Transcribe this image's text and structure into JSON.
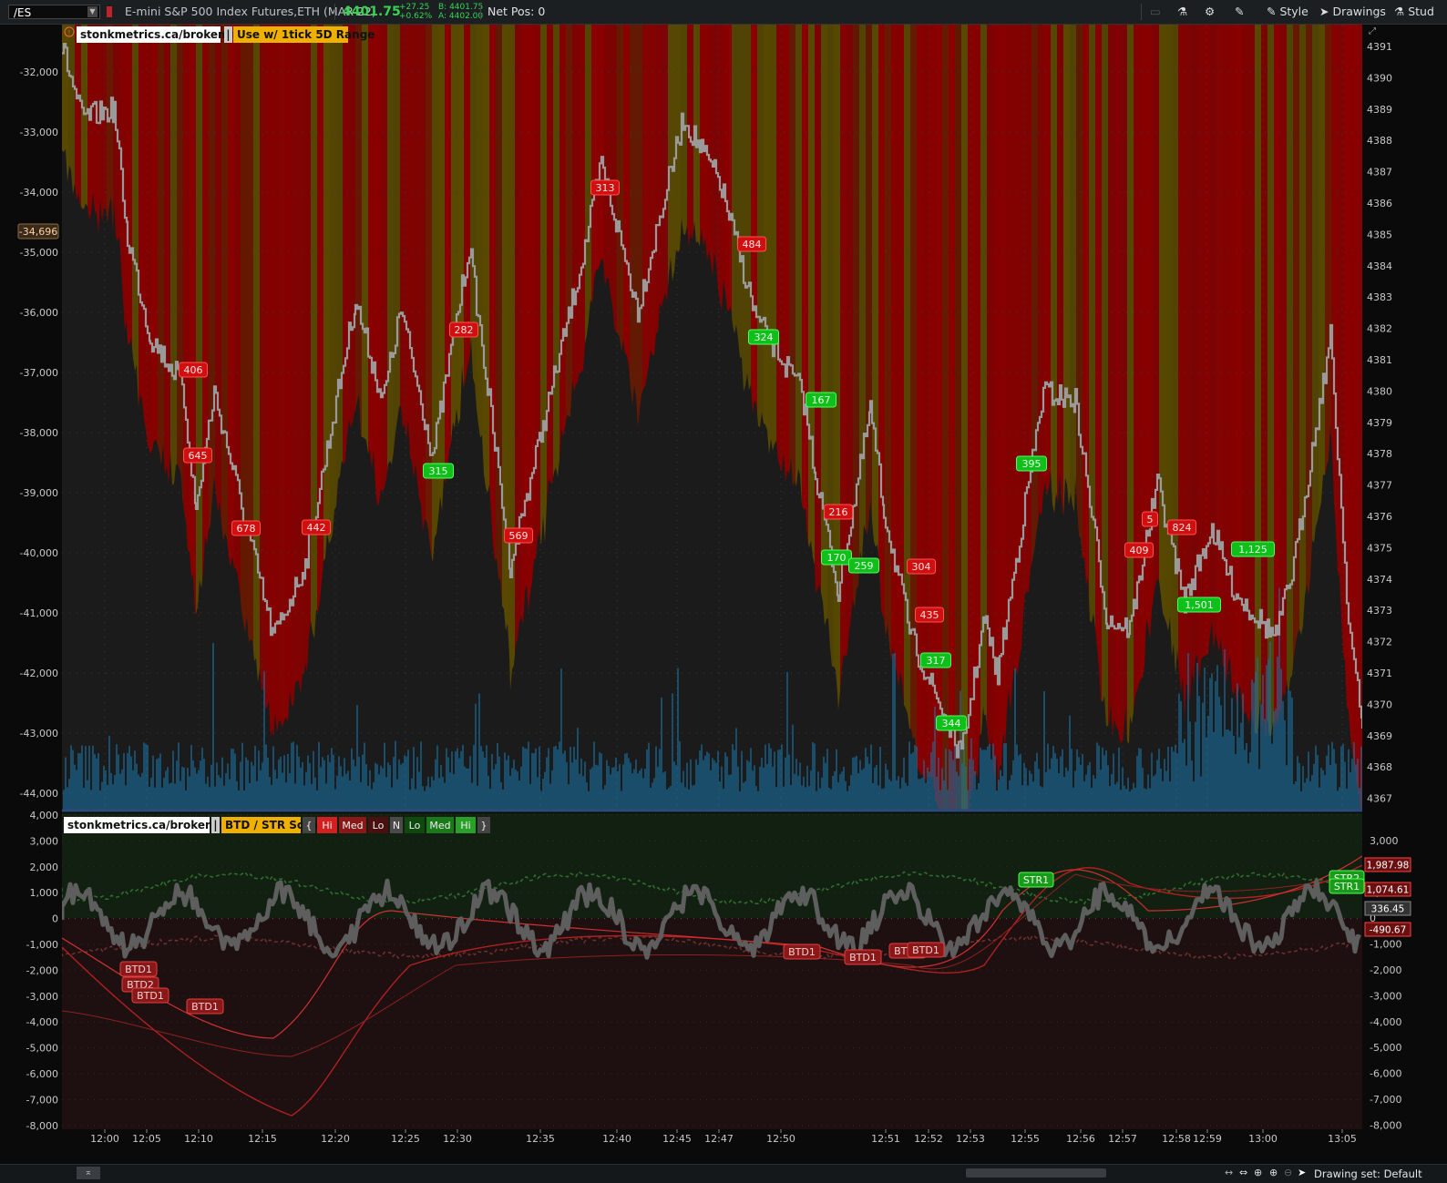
{
  "toolbar": {
    "symbol": "/ES",
    "description": "E-mini S&P 500 Index Futures,ETH (MAR 22)",
    "last_price": "4401.75",
    "change": "+27.25",
    "change_pct": "+0.62%",
    "bid": "B: 4401.75",
    "ask": "A: 4402.00",
    "net_pos": "Net Pos: 0",
    "style_label": "Style",
    "drawings_label": "Drawings",
    "studies_label": "Stud",
    "colors": {
      "up": "#39d353",
      "bg": "#1c1f22"
    }
  },
  "upper_panel": {
    "study_label": "stonkmetrics.ca/brokemap",
    "bar_divider": "|",
    "note_label": "Use w/ 1tick 5D Range",
    "left_axis_ticks": [
      "-32,000",
      "-33,000",
      "-34,000",
      "-35,000",
      "-36,000",
      "-37,000",
      "-38,000",
      "-39,000",
      "-40,000",
      "-41,000",
      "-42,000",
      "-43,000",
      "-44,000"
    ],
    "right_axis_ticks": [
      "4391",
      "4390",
      "4389",
      "4388",
      "4387",
      "4386",
      "4385",
      "4384",
      "4383",
      "4382",
      "4381",
      "4380",
      "4379",
      "4378",
      "4377",
      "4376",
      "4375",
      "4374",
      "4373",
      "4372",
      "4371",
      "4370",
      "4369",
      "4368",
      "4367"
    ],
    "current_value_badge": "-34,696",
    "red_labels": [
      "406",
      "645",
      "678",
      "442",
      "282",
      "569",
      "313",
      "484",
      "216",
      "304",
      "435",
      "409",
      "5",
      "824"
    ],
    "green_labels": [
      "315",
      "324",
      "167",
      "170",
      "259",
      "317",
      "344",
      "395",
      "1,501",
      "1,125"
    ],
    "colors": {
      "red": "#8b0000",
      "olive": "#5a4a00",
      "volume": "#1b6f9e",
      "price_line": "#9a9a9a"
    }
  },
  "lower_panel": {
    "study_label": "stonkmetrics.ca/brokemap",
    "scale_label": "BTD / STR Scale",
    "scale_items": [
      "{",
      "Hi",
      "Med",
      "Lo",
      "N",
      "Lo",
      "Med",
      "Hi",
      "}"
    ],
    "left_axis_ticks": [
      "4,000",
      "3,000",
      "2,000",
      "1,000",
      "0",
      "-1,000",
      "-2,000",
      "-3,000",
      "-4,000",
      "-5,000",
      "-6,000",
      "-7,000",
      "-8,000"
    ],
    "right_axis_ticks": [
      "3,000",
      "2,000",
      "1,000",
      "0",
      "-1,000",
      "-2,000",
      "-3,000",
      "-4,000",
      "-5,000",
      "-6,000",
      "-7,000",
      "-8,000"
    ],
    "btd_labels": [
      "BTD1",
      "BTD2",
      "BTD1",
      "BTD1",
      "BTD1",
      "BTD1",
      "BTD1",
      "BTD1"
    ],
    "str_labels": [
      "STR1",
      "STR2",
      "STR1"
    ],
    "right_values": [
      "1,987.98",
      "1,074.61",
      "336.45",
      "-490.67"
    ]
  },
  "time_axis": [
    "12:00",
    "12:05",
    "12:10",
    "12:15",
    "12:20",
    "12:25",
    "12:30",
    "12:35",
    "12:40",
    "12:45",
    "12:47",
    "12:50",
    "12:51",
    "12:52",
    "12:53",
    "12:55",
    "12:56",
    "12:57",
    "12:58",
    "12:59",
    "13:00",
    "13:05"
  ],
  "status": {
    "drawing_set": "Drawing set: Default"
  }
}
